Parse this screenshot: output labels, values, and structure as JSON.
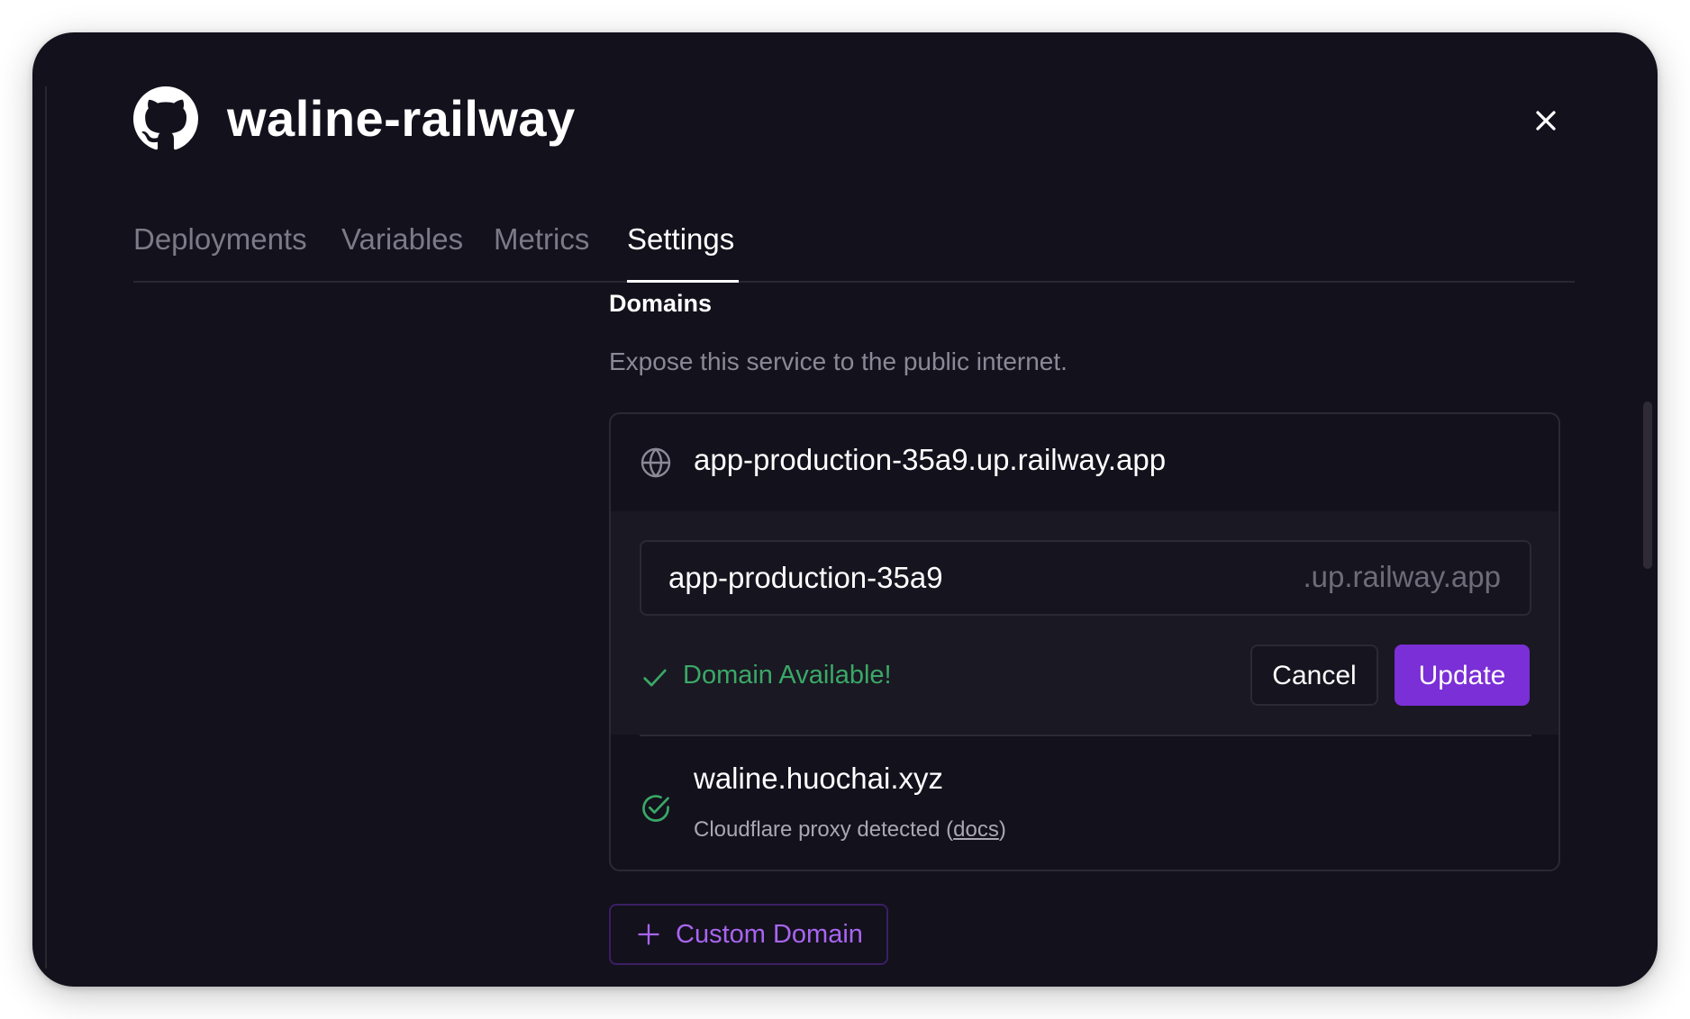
{
  "window": {
    "title": "waline-railway",
    "icon": "github-icon",
    "close_icon": "close-icon"
  },
  "tabs": [
    {
      "label": "Deployments",
      "active": false
    },
    {
      "label": "Variables",
      "active": false
    },
    {
      "label": "Metrics",
      "active": false
    },
    {
      "label": "Settings",
      "active": true
    }
  ],
  "domains": {
    "title": "Domains",
    "description": "Expose this service to the public internet.",
    "railway_domain": {
      "icon": "globe-icon",
      "value": "app-production-35a9.up.railway.app"
    },
    "edit": {
      "input_value": "app-production-35a9",
      "suffix": ".up.railway.app",
      "status_icon": "check-icon",
      "status_text": "Domain Available!",
      "cancel_label": "Cancel",
      "update_label": "Update"
    },
    "custom_domain": {
      "icon": "verified-check-circle-icon",
      "name": "waline.huochai.xyz",
      "note_prefix": "Cloudflare proxy detected (",
      "note_link": "docs",
      "note_suffix": ")"
    },
    "add_button": {
      "icon": "plus-icon",
      "label": "Custom Domain"
    }
  },
  "colors": {
    "background": "#13111c",
    "panel": "#1a1822",
    "border": "#2c2936",
    "accent": "#7b2fd6",
    "accent_text": "#a865f0",
    "success": "#3aa867",
    "muted_text": "#7c7a86"
  }
}
